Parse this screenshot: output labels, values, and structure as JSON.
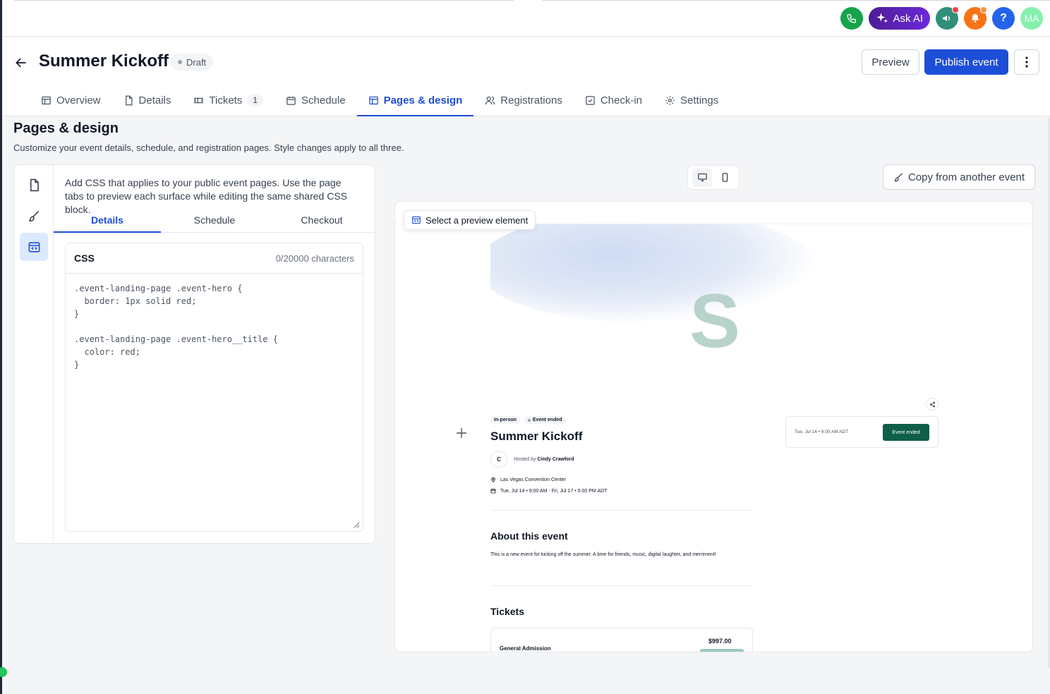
{
  "topbar": {
    "ask_ai_label": "Ask AI",
    "help_label": "?",
    "avatar_initials": "MA"
  },
  "header": {
    "event_title": "Summer Kickoff",
    "status_badge": "Draft",
    "preview_label": "Preview",
    "publish_label": "Publish event",
    "tabs": [
      {
        "label": "Overview"
      },
      {
        "label": "Details"
      },
      {
        "label": "Tickets",
        "count": "1"
      },
      {
        "label": "Schedule"
      },
      {
        "label": "Pages & design",
        "active": true
      },
      {
        "label": "Registrations"
      },
      {
        "label": "Check-in"
      },
      {
        "label": "Settings"
      }
    ]
  },
  "page": {
    "title": "Pages & design",
    "subtitle": "Customize your event details, schedule, and registration pages. Style changes apply to all three."
  },
  "css_panel": {
    "description": "Add CSS that applies to your public event pages. Use the page tabs to preview each surface while editing the same shared CSS block.",
    "subtabs": [
      {
        "label": "Details",
        "active": true
      },
      {
        "label": "Schedule"
      },
      {
        "label": "Checkout"
      }
    ],
    "editor_label": "CSS",
    "char_count": "0/20000 characters",
    "code": ".event-landing-page .event-hero {\n  border: 1px solid red;\n}\n\n.event-landing-page .event-hero__title {\n  color: red;\n}"
  },
  "toolbar": {
    "copy_label": "Copy from another event"
  },
  "preview": {
    "select_tip": "Select a preview element",
    "hero_letter": "S",
    "chip_type": "In-person",
    "chip_status": "Event ended",
    "event_title": "Summer Kickoff",
    "host_initial": "C",
    "host_prefix": "Hosted by",
    "host_name": "Cindy Crawford",
    "location": "Las Vegas Convention Center",
    "datetime": "Tue, Jul 14 • 9:00 AM - Fri, Jul 17 • 5:00 PM ADT",
    "card_date": "Tue, Jul 14 • 9:00 AM ADT",
    "card_button": "Event ended",
    "about_heading": "About this event",
    "about_text": "This is a new event for kicking off the summer. A time for friends, music, digital laughter, and merriment!",
    "tickets_heading": "Tickets",
    "ticket_name": "General Admission",
    "ticket_price": "$997.00"
  },
  "colors": {
    "primary": "#1d4ed8",
    "ended_button": "#0f5f4a"
  }
}
